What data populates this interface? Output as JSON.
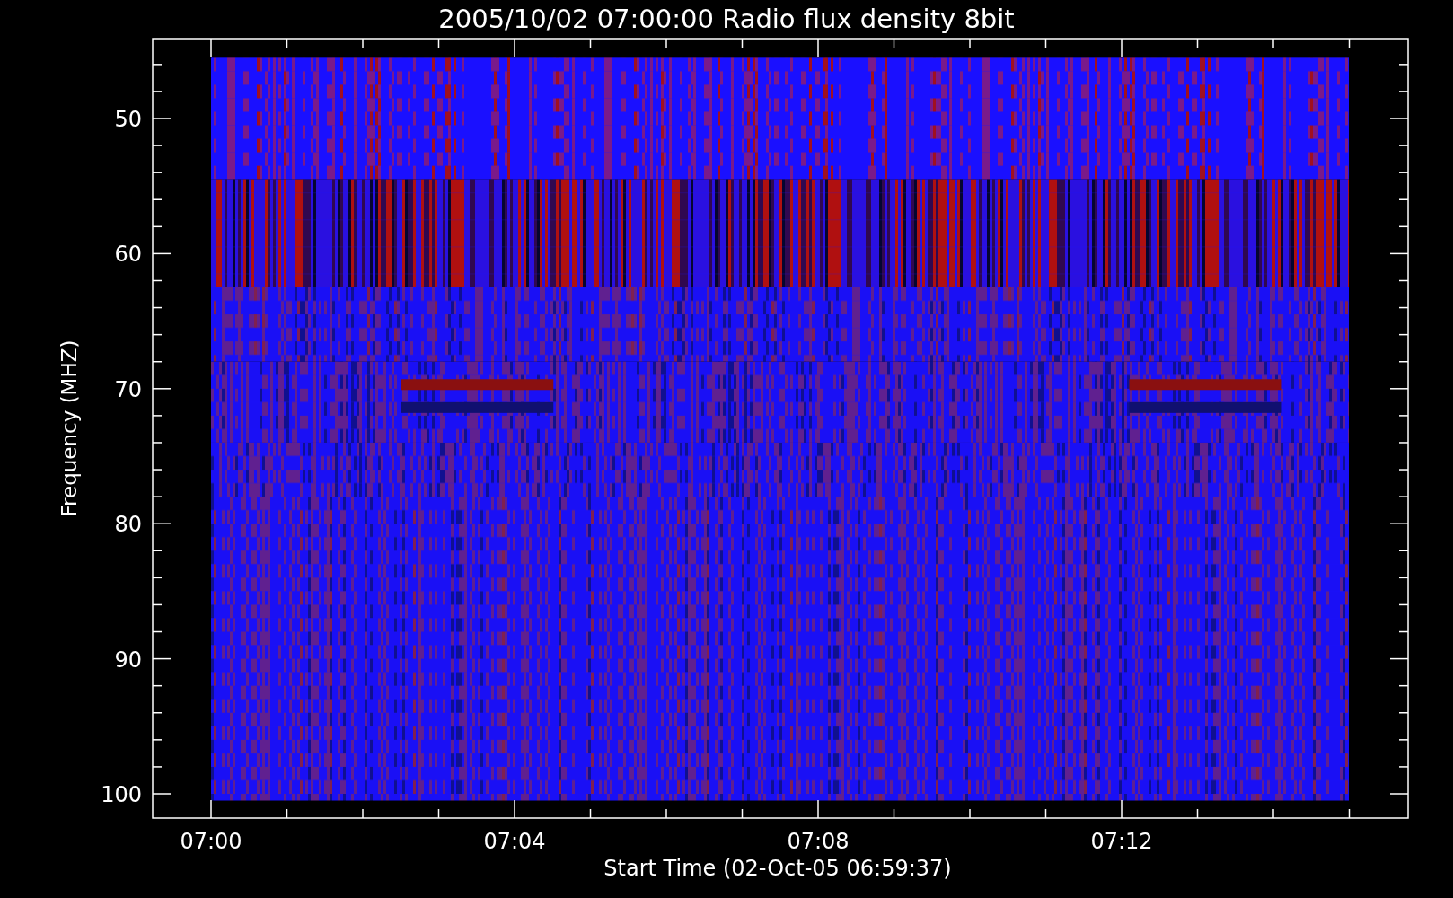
{
  "title": "2005/10/02 07:00:00 Radio flux density 8bit",
  "y_axis": {
    "label": "Frequency (MHZ)",
    "ticks": [
      "50",
      "60",
      "70",
      "80",
      "90",
      "100"
    ]
  },
  "x_axis": {
    "label": "Start Time (02-Oct-05 06:59:37)",
    "ticks": [
      "07:00",
      "07:04",
      "07:08",
      "07:12"
    ]
  }
}
